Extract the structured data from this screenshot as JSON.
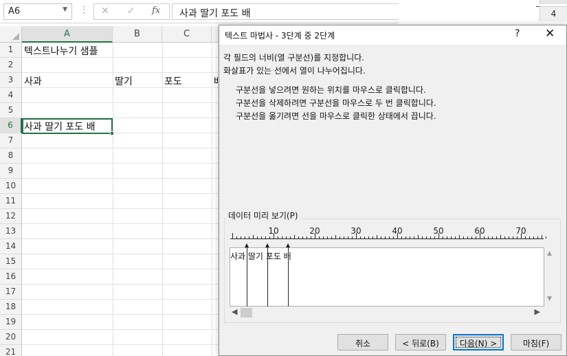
{
  "formula_bar": {
    "name_box": "A6",
    "dots": "⋮",
    "cancel_icon": "✕",
    "enter_icon": "✓",
    "fx_label": "fx",
    "content": "사과 딸기 포도 배"
  },
  "side_window": {
    "row_number": "4"
  },
  "grid": {
    "columns": [
      "A",
      "B",
      "C"
    ],
    "rows": [
      "1",
      "2",
      "3",
      "4",
      "5",
      "6",
      "7",
      "8",
      "9",
      "10",
      "11",
      "12",
      "13",
      "14",
      "15",
      "16",
      "17",
      "18",
      "19",
      "20",
      "21"
    ],
    "cells": {
      "a1": "텍스트나누기 샘플",
      "a3": "사과",
      "b3": "딸기",
      "c3": "포도",
      "d3": "배",
      "a6": "사과 딸기 포도 배"
    }
  },
  "dialog": {
    "title": "텍스트 마법사 - 3단계 중 2단계",
    "help": "?",
    "close": "✕",
    "desc_line1": "각 필드의 너비(열 구분선)를 지정합니다.",
    "desc_line2": "화살표가 있는 선에서 열이 나누어집니다.",
    "inst_line1": "구분선을 넣으려면 원하는 위치를 마우스로 클릭합니다.",
    "inst_line2": "구분선을 삭제하려면 구분선을 마우스로 두 번 클릭합니다.",
    "inst_line3": "구분선을 옮기려면 선을 마우스로 클릭한 상태에서 끕니다.",
    "preview_label": "데이터 미리 보기(P)",
    "ruler_labels": [
      "10",
      "20",
      "30",
      "40",
      "50",
      "60",
      "70"
    ],
    "preview_text": "사과 딸기 포도 배",
    "column_breaks": [
      4,
      9,
      14
    ],
    "buttons": {
      "cancel": "취소",
      "back": "< 뒤로(B)",
      "next": "다음(N) >",
      "finish": "마침(F)"
    }
  }
}
